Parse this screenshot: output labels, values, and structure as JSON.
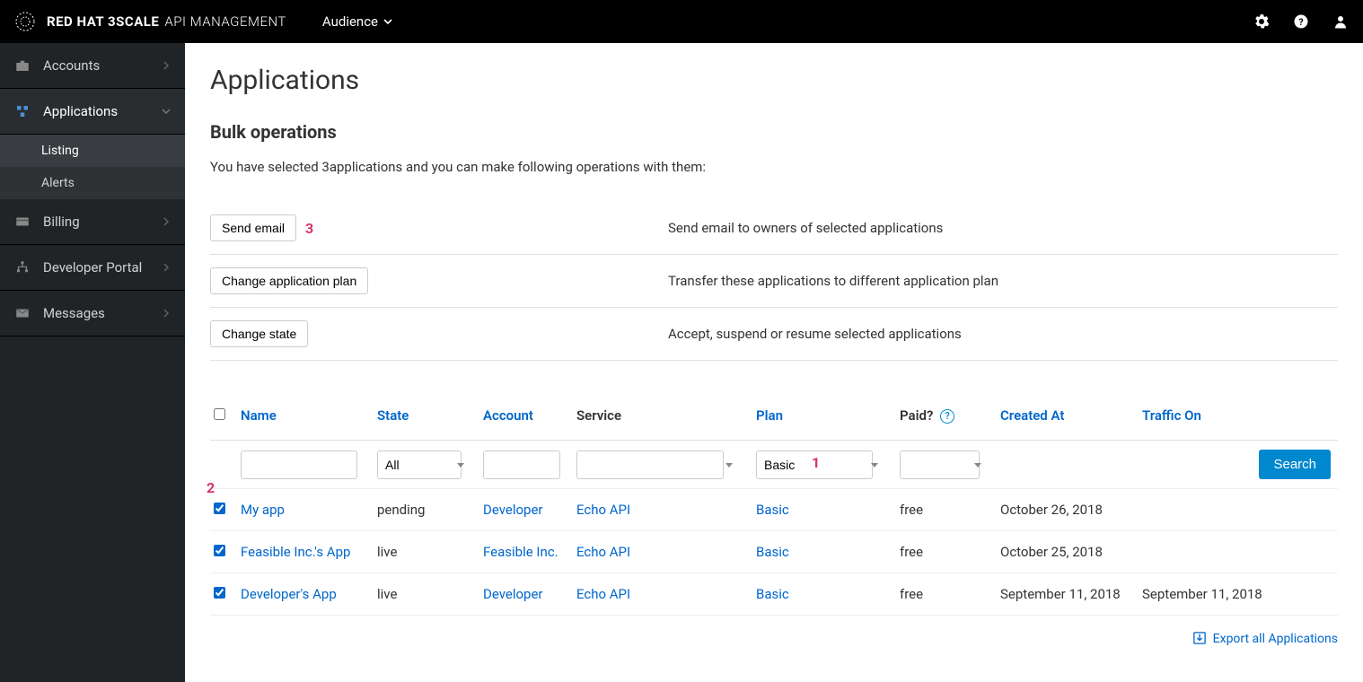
{
  "brand": {
    "name": "RED HAT 3SCALE",
    "sub": "API MANAGEMENT"
  },
  "topnav": {
    "audience": "Audience"
  },
  "sidebar": {
    "items": [
      {
        "label": "Accounts"
      },
      {
        "label": "Applications"
      },
      {
        "label": "Billing"
      },
      {
        "label": "Developer Portal"
      },
      {
        "label": "Messages"
      }
    ],
    "sub": [
      {
        "label": "Listing"
      },
      {
        "label": "Alerts"
      }
    ]
  },
  "page": {
    "title": "Applications",
    "bulk_title": "Bulk operations",
    "bulk_desc": "You have selected 3applications and you can make following operations with them:"
  },
  "bulk_ops": [
    {
      "button": "Send email",
      "desc": "Send email to owners of selected applications",
      "annot": "3"
    },
    {
      "button": "Change application plan",
      "desc": "Transfer these applications to different application plan",
      "annot": ""
    },
    {
      "button": "Change state",
      "desc": "Accept, suspend or resume selected applications",
      "annot": ""
    }
  ],
  "table": {
    "headers": {
      "name": "Name",
      "state": "State",
      "account": "Account",
      "service": "Service",
      "plan": "Plan",
      "paid": "Paid?",
      "created": "Created At",
      "traffic": "Traffic On"
    },
    "filters": {
      "state": "All",
      "plan": "Basic"
    },
    "search_label": "Search",
    "rows": [
      {
        "name": "My app",
        "state": "pending",
        "account": "Developer",
        "service": "Echo API",
        "plan": "Basic",
        "paid": "free",
        "created": "October 26, 2018",
        "traffic": ""
      },
      {
        "name": "Feasible Inc.'s App",
        "state": "live",
        "account": "Feasible Inc.",
        "service": "Echo API",
        "plan": "Basic",
        "paid": "free",
        "created": "October 25, 2018",
        "traffic": ""
      },
      {
        "name": "Developer's App",
        "state": "live",
        "account": "Developer",
        "service": "Echo API",
        "plan": "Basic",
        "paid": "free",
        "created": "September 11, 2018",
        "traffic": "September 11, 2018"
      }
    ]
  },
  "export_label": "Export all Applications",
  "annotations": {
    "plan_select": "1",
    "row_check": "2"
  }
}
